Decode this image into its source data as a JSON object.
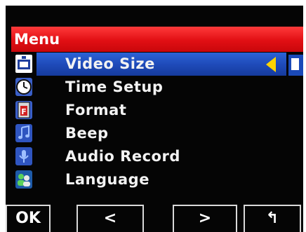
{
  "menu": {
    "title": "Menu",
    "items": [
      {
        "label": "Video Size",
        "icon": "video-size-icon",
        "selected": true
      },
      {
        "label": "Time Setup",
        "icon": "clock-icon",
        "selected": false
      },
      {
        "label": "Format",
        "icon": "format-card-icon",
        "selected": false
      },
      {
        "label": "Beep",
        "icon": "music-note-icon",
        "selected": false
      },
      {
        "label": "Audio Record",
        "icon": "microphone-icon",
        "selected": false
      },
      {
        "label": "Language",
        "icon": "language-people-icon",
        "selected": false
      }
    ]
  },
  "softkeys": {
    "ok": "OK",
    "left": "<",
    "right": ">",
    "back": "↰"
  },
  "colors": {
    "header": "#e10f14",
    "selection": "#1e49b7",
    "pointer": "#ffd400",
    "background": "#050505",
    "text": "#f2f2f2"
  }
}
